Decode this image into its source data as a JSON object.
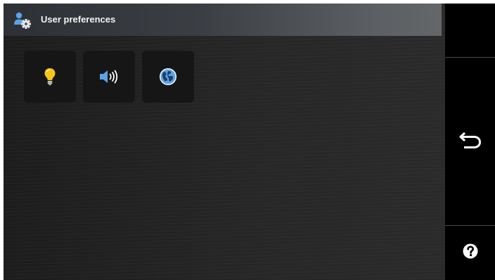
{
  "header": {
    "title": "User preferences",
    "icon": "user-settings-icon"
  },
  "tiles": [
    {
      "icon": "lightbulb-icon",
      "color": "#f5c518"
    },
    {
      "icon": "speaker-icon",
      "color": "#5aa3e8"
    },
    {
      "icon": "globe-icon",
      "color": "#5aa3e8"
    }
  ],
  "side_buttons": [
    {
      "icon": "back-arrow-icon"
    },
    {
      "icon": "help-icon"
    }
  ],
  "colors": {
    "accent_blue": "#5aa3e8",
    "bulb_yellow": "#f5c518",
    "background": "#222222",
    "tile": "#161616"
  }
}
